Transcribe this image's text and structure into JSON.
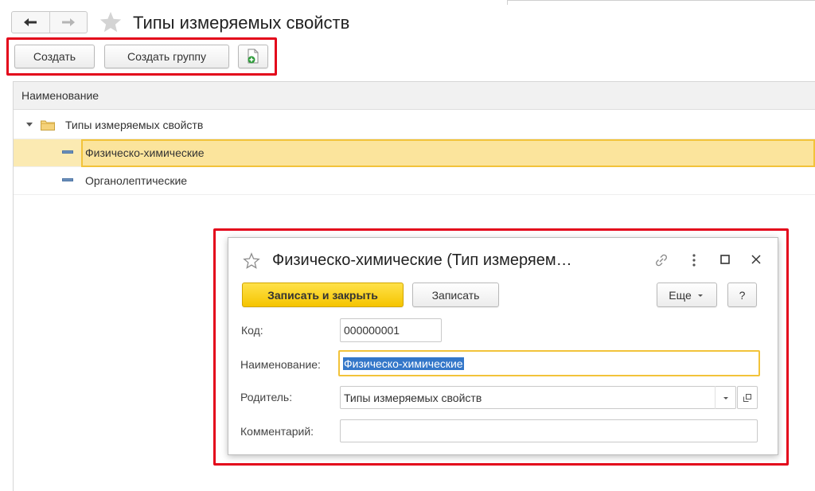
{
  "header": {
    "title": "Типы измеряемых свойств",
    "back_icon": "arrow-left-icon",
    "forward_icon": "arrow-right-icon",
    "favorite_icon": "star-icon"
  },
  "toolbar": {
    "create_label": "Создать",
    "create_group_label": "Создать группу",
    "add_icon": "document-add-icon"
  },
  "list": {
    "column_header": "Наименование",
    "rows": [
      {
        "label": "Типы измеряемых свойств",
        "type": "group",
        "expanded": true
      },
      {
        "label": "Физическо-химические",
        "type": "item",
        "selected": true
      },
      {
        "label": "Органолептические",
        "type": "item",
        "selected": false
      }
    ]
  },
  "dialog": {
    "title": "Физическо-химические (Тип измеряем…",
    "save_close_label": "Записать и закрыть",
    "save_label": "Записать",
    "more_label": "Еще",
    "help_label": "?",
    "fields": {
      "code_label": "Код:",
      "code_value": "000000001",
      "name_label": "Наименование:",
      "name_value": "Физическо-химические",
      "parent_label": "Родитель:",
      "parent_value": "Типы измеряемых свойств",
      "comment_label": "Комментарий:",
      "comment_value": ""
    }
  },
  "colors": {
    "accent_yellow": "#f5c400",
    "selection": "#fbe49c",
    "highlight_frame": "#e3061b",
    "text_selection": "#3477c9"
  }
}
